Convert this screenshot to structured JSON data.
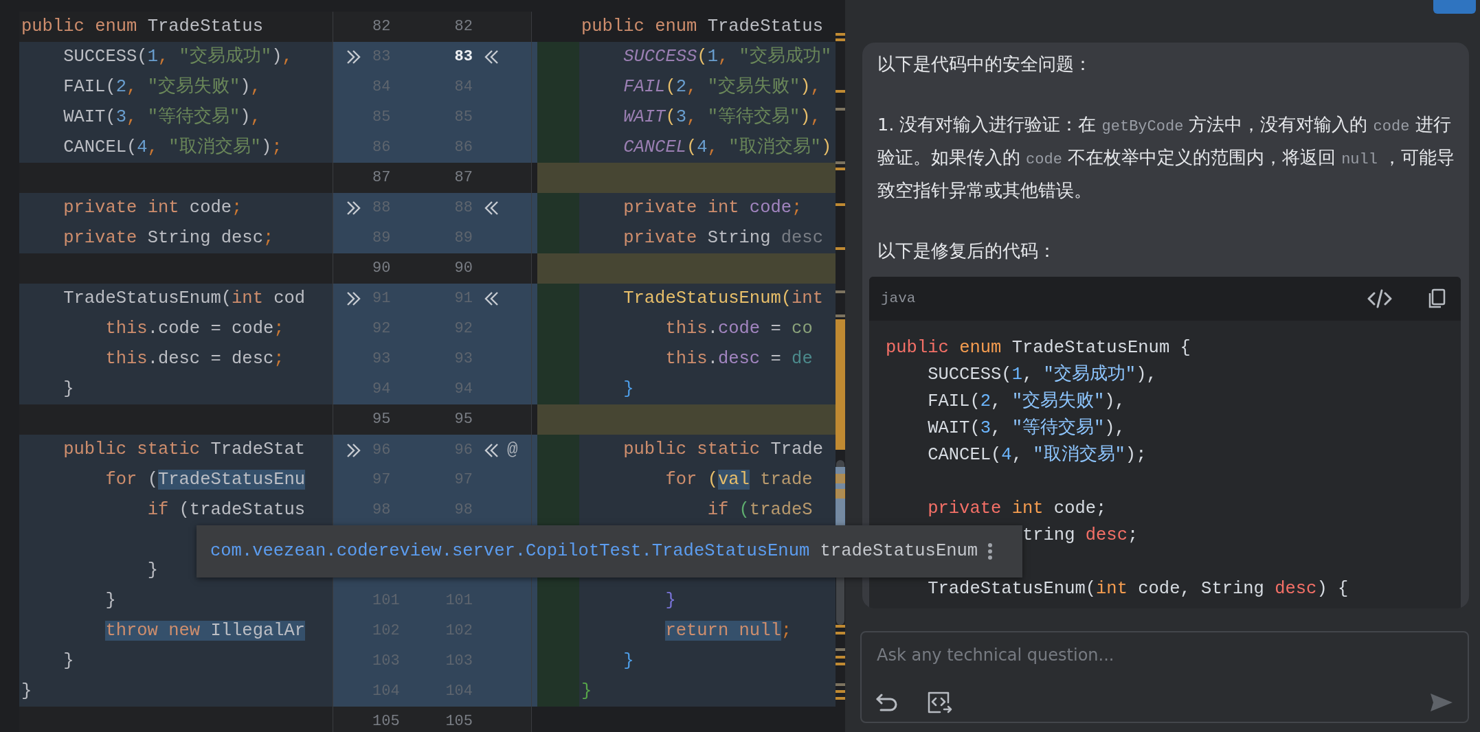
{
  "diff": {
    "rows": [
      {
        "left_no": "82",
        "right_no": "82",
        "right_current": false,
        "actions": false,
        "left": {
          "changed": false,
          "tokens": [
            {
              "text": "public ",
              "kind": "kw"
            },
            {
              "text": "enum ",
              "kind": "kw"
            },
            {
              "text": "TradeStatus",
              "kind": "plain"
            }
          ]
        },
        "right": {
          "kind": "plain",
          "tokens": [
            {
              "text": "public ",
              "kind": "kw"
            },
            {
              "text": "enum ",
              "kind": "kw"
            },
            {
              "text": "TradeStatus",
              "kind": "plain"
            }
          ]
        }
      },
      {
        "left_no": "83",
        "right_no": "83",
        "right_current": true,
        "actions": true,
        "left": {
          "changed": true,
          "tokens": [
            {
              "text": "    SUCCESS(",
              "kind": "plain"
            },
            {
              "text": "1",
              "kind": "num"
            },
            {
              "text": ",",
              "kind": "sep"
            },
            {
              "text": " \"交易成功\"",
              "kind": "str"
            },
            {
              "text": ")",
              "kind": "plain"
            },
            {
              "text": ",",
              "kind": "sep"
            }
          ]
        },
        "right": {
          "kind": "changed",
          "tokens": [
            {
              "text": "    SUCCESS",
              "kind": "const"
            },
            {
              "text": "(",
              "kind": "paren"
            },
            {
              "text": "1",
              "kind": "num"
            },
            {
              "text": ",",
              "kind": "sep"
            },
            {
              "text": " \"交易成功\"",
              "kind": "str"
            }
          ]
        }
      },
      {
        "left_no": "84",
        "right_no": "84",
        "right_current": false,
        "actions": false,
        "left": {
          "changed": true,
          "tokens": [
            {
              "text": "    FAIL(",
              "kind": "plain"
            },
            {
              "text": "2",
              "kind": "num"
            },
            {
              "text": ",",
              "kind": "sep"
            },
            {
              "text": " \"交易失败\"",
              "kind": "str"
            },
            {
              "text": ")",
              "kind": "plain"
            },
            {
              "text": ",",
              "kind": "sep"
            }
          ]
        },
        "right": {
          "kind": "changed",
          "tokens": [
            {
              "text": "    FAIL",
              "kind": "const"
            },
            {
              "text": "(",
              "kind": "paren"
            },
            {
              "text": "2",
              "kind": "num"
            },
            {
              "text": ",",
              "kind": "sep"
            },
            {
              "text": " \"交易失败\"",
              "kind": "str"
            },
            {
              "text": ")",
              "kind": "paren"
            },
            {
              "text": ",",
              "kind": "sep"
            }
          ]
        }
      },
      {
        "left_no": "85",
        "right_no": "85",
        "right_current": false,
        "actions": false,
        "left": {
          "changed": true,
          "tokens": [
            {
              "text": "    WAIT(",
              "kind": "plain"
            },
            {
              "text": "3",
              "kind": "num"
            },
            {
              "text": ",",
              "kind": "sep"
            },
            {
              "text": " \"等待交易\"",
              "kind": "str"
            },
            {
              "text": ")",
              "kind": "plain"
            },
            {
              "text": ",",
              "kind": "sep"
            }
          ]
        },
        "right": {
          "kind": "changed",
          "tokens": [
            {
              "text": "    WAIT",
              "kind": "const"
            },
            {
              "text": "(",
              "kind": "paren"
            },
            {
              "text": "3",
              "kind": "num"
            },
            {
              "text": ",",
              "kind": "sep"
            },
            {
              "text": " \"等待交易\"",
              "kind": "str"
            },
            {
              "text": ")",
              "kind": "paren"
            },
            {
              "text": ",",
              "kind": "sep"
            }
          ]
        }
      },
      {
        "left_no": "86",
        "right_no": "86",
        "right_current": false,
        "actions": false,
        "left": {
          "changed": true,
          "tokens": [
            {
              "text": "    CANCEL(",
              "kind": "plain"
            },
            {
              "text": "4",
              "kind": "num"
            },
            {
              "text": ",",
              "kind": "sep"
            },
            {
              "text": " \"取消交易\"",
              "kind": "str"
            },
            {
              "text": ")",
              "kind": "plain"
            },
            {
              "text": ";",
              "kind": "sep"
            }
          ]
        },
        "right": {
          "kind": "changed",
          "tokens": [
            {
              "text": "    CANCEL",
              "kind": "const"
            },
            {
              "text": "(",
              "kind": "paren"
            },
            {
              "text": "4",
              "kind": "num"
            },
            {
              "text": ",",
              "kind": "sep"
            },
            {
              "text": " \"取消交易\"",
              "kind": "str"
            },
            {
              "text": ")",
              "kind": "paren"
            }
          ]
        }
      },
      {
        "left_no": "87",
        "right_no": "87",
        "right_current": false,
        "actions": false,
        "left": {
          "changed": false
        },
        "right": {
          "kind": "inserted"
        }
      },
      {
        "left_no": "88",
        "right_no": "88",
        "right_current": false,
        "actions": true,
        "left": {
          "changed": true,
          "tokens": [
            {
              "text": "    private ",
              "kind": "kw"
            },
            {
              "text": "int ",
              "kind": "kw"
            },
            {
              "text": "code",
              "kind": "plain"
            },
            {
              "text": ";",
              "kind": "sep"
            }
          ]
        },
        "right": {
          "kind": "changed",
          "tokens": [
            {
              "text": "    private ",
              "kind": "kw"
            },
            {
              "text": "int ",
              "kind": "kw"
            },
            {
              "text": "code",
              "kind": "field"
            },
            {
              "text": ";",
              "kind": "sep"
            }
          ]
        }
      },
      {
        "left_no": "89",
        "right_no": "89",
        "right_current": false,
        "actions": false,
        "left": {
          "changed": true,
          "tokens": [
            {
              "text": "    private ",
              "kind": "kw"
            },
            {
              "text": "String desc",
              "kind": "plain"
            },
            {
              "text": ";",
              "kind": "sep"
            }
          ]
        },
        "right": {
          "kind": "changed",
          "tokens": [
            {
              "text": "    private ",
              "kind": "kw"
            },
            {
              "text": "String ",
              "kind": "plain"
            },
            {
              "text": "desc",
              "kind": "dim"
            }
          ]
        }
      },
      {
        "left_no": "90",
        "right_no": "90",
        "right_current": false,
        "actions": false,
        "left": {
          "changed": false
        },
        "right": {
          "kind": "inserted"
        }
      },
      {
        "left_no": "91",
        "right_no": "91",
        "right_current": false,
        "actions": true,
        "left": {
          "changed": true,
          "tokens": [
            {
              "text": "    TradeStatusEnum(",
              "kind": "plain"
            },
            {
              "text": "int ",
              "kind": "kw"
            },
            {
              "text": "cod",
              "kind": "plain"
            }
          ]
        },
        "right": {
          "kind": "changed",
          "tokens": [
            {
              "text": "    TradeStatusEnum",
              "kind": "method"
            },
            {
              "text": "(",
              "kind": "paren"
            },
            {
              "text": "int",
              "kind": "kw"
            }
          ]
        }
      },
      {
        "left_no": "92",
        "right_no": "92",
        "right_current": false,
        "actions": false,
        "left": {
          "changed": true,
          "tokens": [
            {
              "text": "        this",
              "kind": "kw"
            },
            {
              "text": ".code = code",
              "kind": "plain"
            },
            {
              "text": ";",
              "kind": "sep"
            }
          ]
        },
        "right": {
          "kind": "changed",
          "tokens": [
            {
              "text": "        this",
              "kind": "kw"
            },
            {
              "text": ".",
              "kind": "plain"
            },
            {
              "text": "code",
              "kind": "field"
            },
            {
              "text": " = ",
              "kind": "plain"
            },
            {
              "text": "co",
              "kind": "param"
            }
          ]
        }
      },
      {
        "left_no": "93",
        "right_no": "93",
        "right_current": false,
        "actions": false,
        "left": {
          "changed": true,
          "tokens": [
            {
              "text": "        this",
              "kind": "kw"
            },
            {
              "text": ".desc = desc",
              "kind": "plain"
            },
            {
              "text": ";",
              "kind": "sep"
            }
          ]
        },
        "right": {
          "kind": "changed",
          "tokens": [
            {
              "text": "        this",
              "kind": "kw"
            },
            {
              "text": ".",
              "kind": "plain"
            },
            {
              "text": "desc",
              "kind": "field"
            },
            {
              "text": " = ",
              "kind": "plain"
            },
            {
              "text": "de",
              "kind": "teal"
            }
          ]
        }
      },
      {
        "left_no": "94",
        "right_no": "94",
        "right_current": false,
        "actions": false,
        "left": {
          "changed": true,
          "tokens": [
            {
              "text": "    }",
              "kind": "plain"
            }
          ]
        },
        "right": {
          "kind": "changed",
          "tokens": [
            {
              "text": "    }",
              "kind": "brace1"
            }
          ]
        }
      },
      {
        "left_no": "95",
        "right_no": "95",
        "right_current": false,
        "actions": false,
        "left": {
          "changed": false
        },
        "right": {
          "kind": "inserted"
        }
      },
      {
        "left_no": "96",
        "right_no": "96",
        "right_current": false,
        "actions": true,
        "marker": "@",
        "left": {
          "changed": true,
          "tokens": [
            {
              "text": "    public ",
              "kind": "kw"
            },
            {
              "text": "static ",
              "kind": "kw"
            },
            {
              "text": "TradeStat",
              "kind": "plain"
            }
          ]
        },
        "right": {
          "kind": "changed",
          "tokens": [
            {
              "text": "    public ",
              "kind": "kw"
            },
            {
              "text": "static ",
              "kind": "kw"
            },
            {
              "text": "Trade",
              "kind": "plain"
            }
          ]
        }
      },
      {
        "left_no": "97",
        "right_no": "97",
        "right_current": false,
        "actions": false,
        "left": {
          "changed": true,
          "tokens": [
            {
              "text": "        for ",
              "kind": "kw"
            },
            {
              "text": "(",
              "kind": "plain"
            },
            {
              "text": "TradeStatusEnu",
              "kind": "plain",
              "highlighted": true
            }
          ]
        },
        "right": {
          "kind": "changed",
          "tokens": [
            {
              "text": "        for ",
              "kind": "kw"
            },
            {
              "text": "(",
              "kind": "paren"
            },
            {
              "text": "val",
              "kind": "method",
              "highlighted": true
            },
            {
              "text": " trade",
              "kind": "local"
            }
          ]
        }
      },
      {
        "left_no": "98",
        "right_no": "98",
        "right_current": false,
        "actions": false,
        "left": {
          "changed": true,
          "tokens": [
            {
              "text": "            if ",
              "kind": "kw"
            },
            {
              "text": "(tradeStatus",
              "kind": "plain"
            }
          ]
        },
        "right": {
          "kind": "changed",
          "tokens": [
            {
              "text": "            if ",
              "kind": "kw"
            },
            {
              "text": "(",
              "kind": "paren2"
            },
            {
              "text": "tradeS",
              "kind": "local"
            }
          ]
        }
      },
      {
        "left": {
          "changed": true
        },
        "right": {
          "kind": "changed"
        }
      },
      {
        "actions": false,
        "left": {
          "changed": true,
          "tokens": [
            {
              "text": "            }",
              "kind": "plain"
            }
          ]
        },
        "right": {
          "kind": "changed"
        }
      },
      {
        "left_no": "101",
        "right_no": "101",
        "right_current": false,
        "actions": false,
        "left": {
          "changed": true,
          "tokens": [
            {
              "text": "        }",
              "kind": "plain"
            }
          ]
        },
        "right": {
          "kind": "changed",
          "tokens": [
            {
              "text": "        }",
              "kind": "brace2"
            }
          ]
        }
      },
      {
        "left_no": "102",
        "right_no": "102",
        "right_current": false,
        "actions": false,
        "left": {
          "changed": true,
          "tokens": [
            {
              "text": "        throw new ",
              "kind": "kw",
              "highlighted": true
            },
            {
              "text": "IllegalAr",
              "kind": "plain",
              "highlighted": true
            }
          ]
        },
        "right": {
          "kind": "changed",
          "tokens": [
            {
              "text": "        return null",
              "kind": "kw",
              "highlighted": true
            },
            {
              "text": ";",
              "kind": "sep"
            }
          ]
        }
      },
      {
        "left_no": "103",
        "right_no": "103",
        "right_current": false,
        "actions": false,
        "left": {
          "changed": true,
          "tokens": [
            {
              "text": "    }",
              "kind": "plain"
            }
          ]
        },
        "right": {
          "kind": "changed",
          "tokens": [
            {
              "text": "    }",
              "kind": "brace1"
            }
          ]
        }
      },
      {
        "left_no": "104",
        "right_no": "104",
        "right_current": false,
        "actions": false,
        "left": {
          "changed": true,
          "tokens": [
            {
              "text": "}",
              "kind": "plain"
            }
          ]
        },
        "right": {
          "kind": "changed",
          "tokens": [
            {
              "text": "}",
              "kind": "brace3"
            }
          ]
        }
      },
      {
        "left_no": "105",
        "right_no": "105",
        "right_current": false,
        "actions": false,
        "left": {
          "changed": false
        },
        "right": {
          "kind": "plain"
        }
      }
    ]
  },
  "tooltip": {
    "type_name": "com.veezean.codereview.server.CopilotTest.TradeStatusEnum",
    "variable": "tradeStatusEnum"
  },
  "chat": {
    "message": {
      "paragraphs": [
        [
          {
            "text": "以下是代码中的安全问题：",
            "code": false
          }
        ],
        [
          {
            "text": "1. 没有对输入进行验证：在 ",
            "code": false
          },
          {
            "text": "getByCode",
            "code": true
          },
          {
            "text": " 方法中，没有对输入的 ",
            "code": false
          },
          {
            "text": "code",
            "code": true
          },
          {
            "text": " 进行验证。如果传入的 ",
            "code": false
          },
          {
            "text": "code",
            "code": true
          },
          {
            "text": " 不在枚举中定义的范围内，将返回 ",
            "code": false
          },
          {
            "text": "null",
            "code": true
          },
          {
            "text": " ，可能导致空指针异常或其他错误。",
            "code": false
          }
        ],
        [
          {
            "text": "以下是修复后的代码：",
            "code": false
          }
        ]
      ],
      "code_block": {
        "language": "java",
        "lines": [
          {
            "blank_after": false,
            "tokens": [
              {
                "text": "public ",
                "kind": "ckw"
              },
              {
                "text": "enum ",
                "kind": "ctype"
              },
              {
                "text": "TradeStatusEnum {",
                "kind": "cplain"
              }
            ]
          },
          {
            "blank_after": false,
            "tokens": [
              {
                "text": "    SUCCESS(",
                "kind": "cplain"
              },
              {
                "text": "1",
                "kind": "cnum"
              },
              {
                "text": ", ",
                "kind": "cplain"
              },
              {
                "text": "\"交易成功\"",
                "kind": "cstr"
              },
              {
                "text": "),",
                "kind": "cplain"
              }
            ]
          },
          {
            "blank_after": false,
            "tokens": [
              {
                "text": "    FAIL(",
                "kind": "cplain"
              },
              {
                "text": "2",
                "kind": "cnum"
              },
              {
                "text": ", ",
                "kind": "cplain"
              },
              {
                "text": "\"交易失败\"",
                "kind": "cstr"
              },
              {
                "text": "),",
                "kind": "cplain"
              }
            ]
          },
          {
            "blank_after": false,
            "tokens": [
              {
                "text": "    WAIT(",
                "kind": "cplain"
              },
              {
                "text": "3",
                "kind": "cnum"
              },
              {
                "text": ", ",
                "kind": "cplain"
              },
              {
                "text": "\"等待交易\"",
                "kind": "cstr"
              },
              {
                "text": "),",
                "kind": "cplain"
              }
            ]
          },
          {
            "blank_after": true,
            "tokens": [
              {
                "text": "    CANCEL(",
                "kind": "cplain"
              },
              {
                "text": "4",
                "kind": "cnum"
              },
              {
                "text": ", ",
                "kind": "cplain"
              },
              {
                "text": "\"取消交易\"",
                "kind": "cstr"
              },
              {
                "text": ");",
                "kind": "cplain"
              }
            ]
          },
          {
            "blank_after": false,
            "tokens": [
              {
                "text": "    private ",
                "kind": "ckw"
              },
              {
                "text": "int ",
                "kind": "ctype"
              },
              {
                "text": "code;",
                "kind": "cplain"
              }
            ]
          },
          {
            "blank_after": true,
            "tokens": [
              {
                "text": "             tring ",
                "kind": "cplain"
              },
              {
                "text": "desc",
                "kind": "ckw"
              },
              {
                "text": ";",
                "kind": "cplain"
              }
            ]
          },
          {
            "blank_after": false,
            "tokens": [
              {
                "text": "    TradeStatusEnum(",
                "kind": "cplain"
              },
              {
                "text": "int ",
                "kind": "ctype"
              },
              {
                "text": "code, String ",
                "kind": "cplain"
              },
              {
                "text": "desc",
                "kind": "ckw"
              },
              {
                "text": ") {",
                "kind": "cplain"
              }
            ]
          }
        ]
      }
    },
    "input": {
      "placeholder": "Ask any technical question..."
    }
  }
}
